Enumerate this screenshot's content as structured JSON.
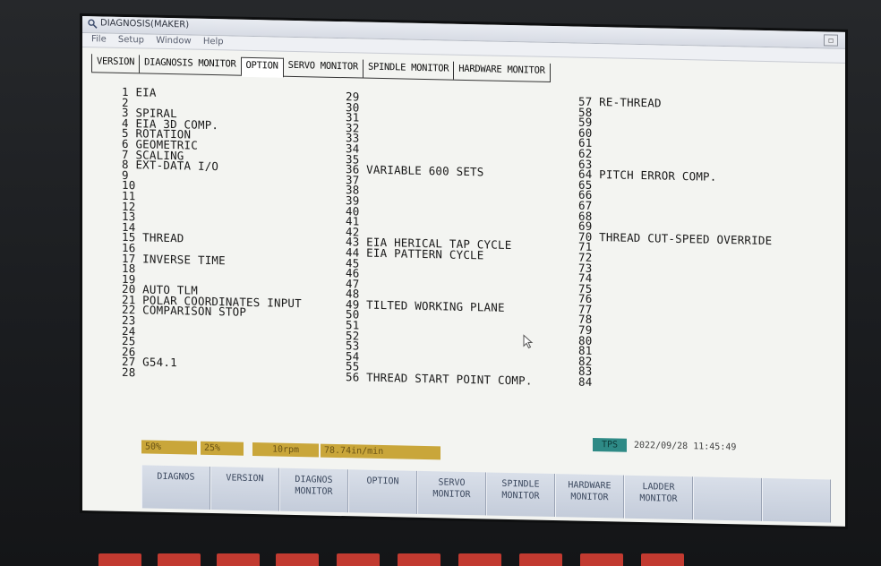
{
  "window": {
    "title": "DIAGNOSIS(MAKER)",
    "maximize_glyph": "□"
  },
  "menu": [
    "File",
    "Setup",
    "Window",
    "Help"
  ],
  "tabs": [
    {
      "label": "VERSION",
      "active": false
    },
    {
      "label": "DIAGNOSIS MONITOR",
      "active": false
    },
    {
      "label": "OPTION",
      "active": true
    },
    {
      "label": "SERVO MONITOR",
      "active": false
    },
    {
      "label": "SPINDLE MONITOR",
      "active": false
    },
    {
      "label": "HARDWARE MONITOR",
      "active": false
    }
  ],
  "options": {
    "col1": [
      "1 EIA",
      "2",
      "3 SPIRAL",
      "4 EIA 3D COMP.",
      "5 ROTATION",
      "6 GEOMETRIC",
      "7 SCALING",
      "8 EXT-DATA I/O",
      "9",
      "10",
      "11",
      "12",
      "13",
      "14",
      "15 THREAD",
      "16",
      "17 INVERSE TIME",
      "18",
      "19",
      "20 AUTO TLM",
      "21 POLAR COORDINATES INPUT",
      "22 COMPARISON STOP",
      "23",
      "24",
      "25",
      "26",
      "27 G54.1",
      "28"
    ],
    "col2": [
      "29",
      "30",
      "31",
      "32",
      "33",
      "34",
      "35",
      "36 VARIABLE 600 SETS",
      "37",
      "38",
      "39",
      "40",
      "41",
      "42",
      "43 EIA HERICAL TAP CYCLE",
      "44 EIA PATTERN CYCLE",
      "45",
      "46",
      "47",
      "48",
      "49 TILTED WORKING PLANE",
      "50",
      "51",
      "52",
      "53",
      "54",
      "55",
      "56 THREAD START POINT COMP."
    ],
    "col3": [
      "57 RE-THREAD",
      "58",
      "59",
      "60",
      "61",
      "62",
      "63",
      "64 PITCH ERROR COMP.",
      "65",
      "66",
      "67",
      "68",
      "69",
      "70 THREAD CUT-SPEED OVERRIDE",
      "71",
      "72",
      "73",
      "74",
      "75",
      "76",
      "77",
      "78",
      "79",
      "80",
      "81",
      "82",
      "83",
      "84"
    ]
  },
  "status": {
    "override_feed": "50%",
    "override_rapid": "25%",
    "spindle_speed": "10rpm",
    "feedrate": "78.74in/min",
    "mode_badge": "TPS",
    "datetime": "2022/09/28  11:45:49"
  },
  "softkeys": [
    "DIAGNOS",
    "VERSION",
    "DIAGNOS\nMONITOR",
    "OPTION",
    "SERVO\nMONITOR",
    "SPINDLE\nMONITOR",
    "HARDWARE\nMONITOR",
    "LADDER\nMONITOR",
    "",
    ""
  ],
  "colors": {
    "screen_bg": "#f3f4f1",
    "status_yellow": "#c9a63a",
    "status_teal": "#2e8a86",
    "softkey_bg": "#cdd4e0",
    "bezel": "#1b1d20",
    "hardkey_red": "#c23a30"
  }
}
